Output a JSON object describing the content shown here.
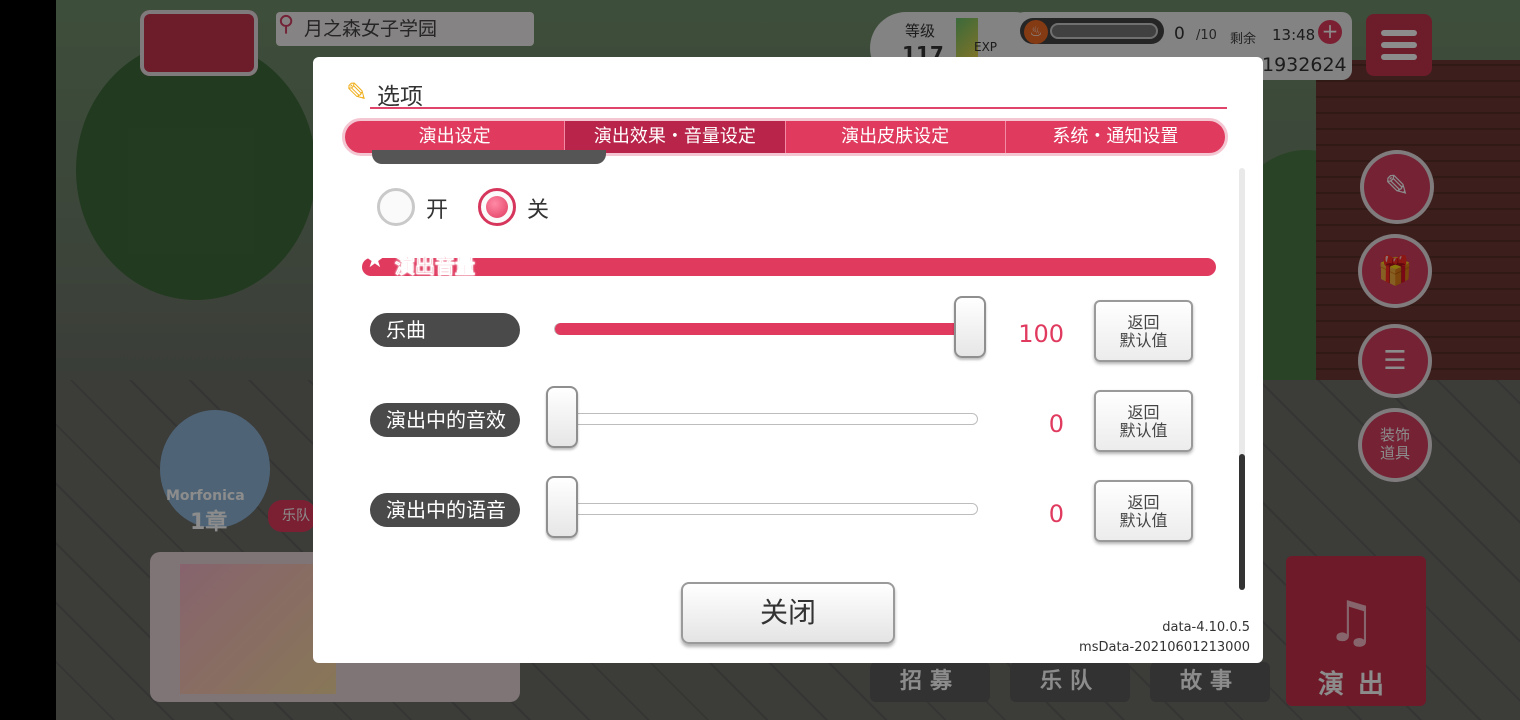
{
  "topbar": {
    "location": "月之森女子学园",
    "level_label": "等级",
    "level_value": "117",
    "exp_label": "EXP",
    "stamina_value": "0",
    "stamina_max": "/10",
    "remaining_label": "剩余",
    "time": "13:48",
    "plus": "+",
    "coins": "1932624"
  },
  "side_buttons": {
    "decor": "装饰\n道具"
  },
  "chapter": {
    "band": "Morfonica",
    "chapter": "1章",
    "tag": "乐队"
  },
  "bottom_nav": {
    "recruit": "招募",
    "band": "乐队",
    "story": "故事",
    "live": "演出"
  },
  "dialog": {
    "title": "选项",
    "tabs": [
      {
        "label": "演出设定",
        "active": false
      },
      {
        "label": "演出效果・音量设定",
        "active": true
      },
      {
        "label": "演出皮肤设定",
        "active": false
      },
      {
        "label": "系统・通知设置",
        "active": false
      }
    ],
    "toggle": {
      "on_label": "开",
      "off_label": "关",
      "selected": "关"
    },
    "volume_section_title": "演出音量",
    "volumes": [
      {
        "label": "乐曲",
        "value": "100",
        "level": 1.0,
        "reset": "返回\n默认值"
      },
      {
        "label": "演出中的音效",
        "value": "0",
        "level": 0.0,
        "reset": "返回\n默认值"
      },
      {
        "label": "演出中的语音",
        "value": "0",
        "level": 0.0,
        "reset": "返回\n默认值"
      }
    ],
    "close_label": "关闭",
    "version_data": "data-4.10.0.5",
    "version_ms": "msData-20210601213000"
  },
  "colors": {
    "accent": "#e03a5f",
    "accent_dark": "#b9244a"
  }
}
